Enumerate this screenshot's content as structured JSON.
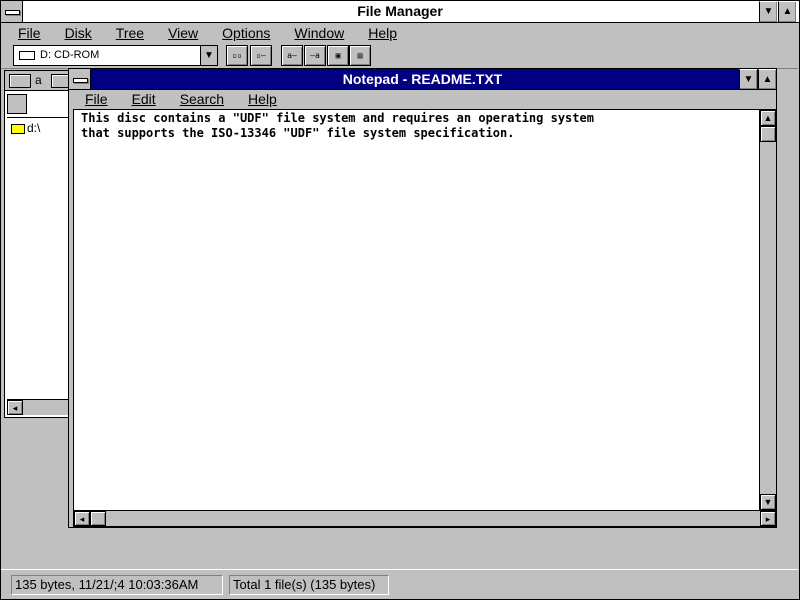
{
  "app": {
    "title": "File Manager",
    "menu": [
      "File",
      "Disk",
      "Tree",
      "View",
      "Options",
      "Window",
      "Help"
    ]
  },
  "toolbar": {
    "drive_selected": "D: CD-ROM",
    "buttons": [
      "connect-drive",
      "disconnect-drive",
      "view-tree",
      "view-dir",
      "sort-name",
      "sort-type",
      "window-tile",
      "window-cascade"
    ]
  },
  "tree": {
    "drive_label": "a",
    "root_label": "d:\\"
  },
  "notepad": {
    "title": "Notepad - README.TXT",
    "menu": [
      "File",
      "Edit",
      "Search",
      "Help"
    ],
    "text": "This disc contains a \"UDF\" file system and requires an operating system\nthat supports the ISO-13346 \"UDF\" file system specification."
  },
  "status": {
    "left": "135 bytes, 11/21/;4 10:03:36AM",
    "right": "Total 1 file(s) (135 bytes)"
  },
  "colors": {
    "active_title": "#000080",
    "window_bg": "#c0c0c0",
    "folder": "#ffff00"
  }
}
